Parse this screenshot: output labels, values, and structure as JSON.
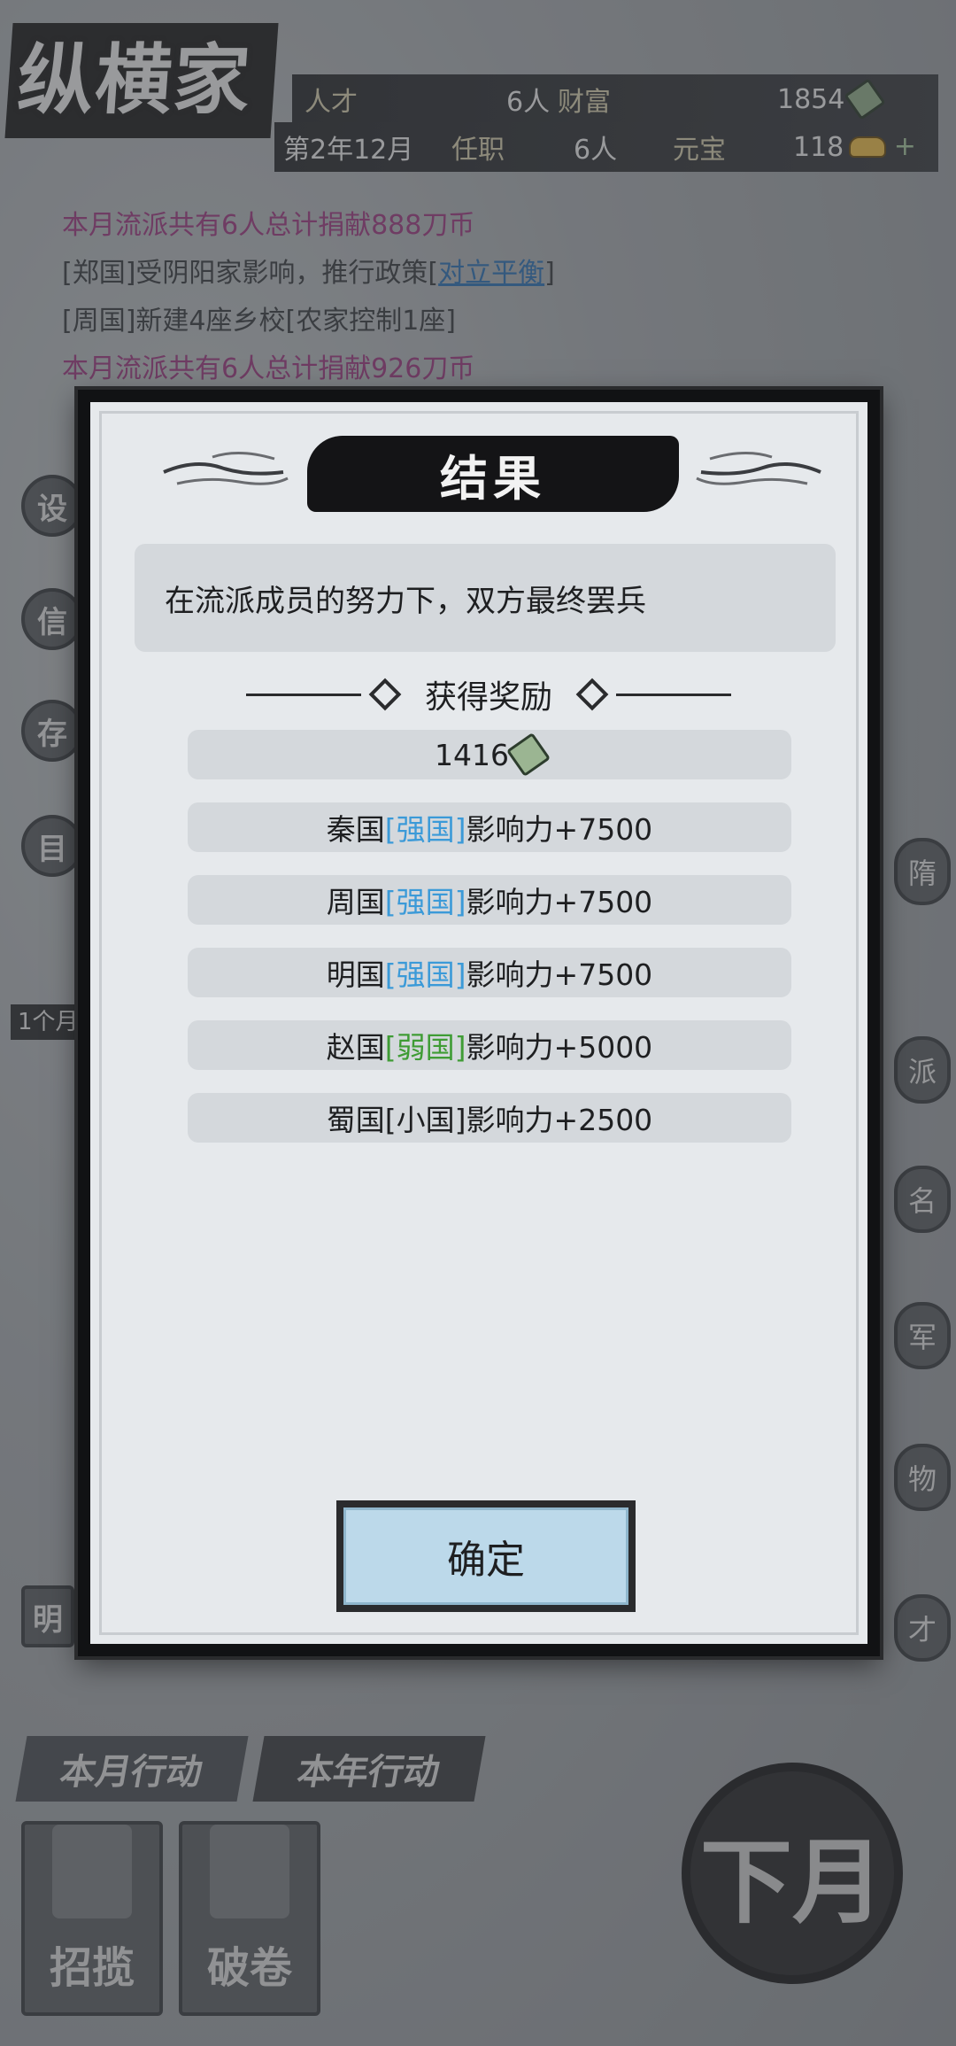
{
  "header": {
    "app_title": "纵横家",
    "row1": [
      {
        "label": "人才",
        "value": "6人"
      },
      {
        "label": "财富",
        "value": "1854"
      }
    ],
    "row2": [
      {
        "label": "",
        "value": "第2年12月"
      },
      {
        "label": "任职",
        "value": "6人"
      },
      {
        "label": "元宝",
        "value": "118"
      }
    ]
  },
  "log": [
    {
      "text": "本月流派共有6人总计捐献888刀币",
      "style": "purple"
    },
    {
      "text_before": "[郑国]受阴阳家影响，推行政策[",
      "link": "对立平衡",
      "text_after": "]",
      "style": "normal"
    },
    {
      "text": "[周国]新建4座乡校[农家控制1座]",
      "style": "normal"
    },
    {
      "text": "本月流派共有6人总计捐献926刀币",
      "style": "purple"
    }
  ],
  "side_left": [
    "设",
    "信",
    "存",
    "目"
  ],
  "side_right": [
    "隋",
    "派",
    "名",
    "军",
    "物",
    "才"
  ],
  "tag_1month": "1个月",
  "left_badge": "明",
  "modal": {
    "title": "结果",
    "message": "在流派成员的努力下，双方最终罢兵",
    "reward_header": "获得奖励",
    "coin_reward": "1416",
    "rewards": [
      {
        "country": "秦国",
        "tier": "[强国]",
        "tier_color": "blue",
        "text": "影响力+7500"
      },
      {
        "country": "周国",
        "tier": "[强国]",
        "tier_color": "blue",
        "text": "影响力+7500"
      },
      {
        "country": "明国",
        "tier": "[强国]",
        "tier_color": "blue",
        "text": "影响力+7500"
      },
      {
        "country": "赵国",
        "tier": "[弱国]",
        "tier_color": "green",
        "text": "影响力+5000"
      },
      {
        "country": "蜀国",
        "tier": "[小国]",
        "tier_color": "plain",
        "text": "影响力+2500"
      }
    ],
    "confirm_label": "确定"
  },
  "bottom": {
    "tabs": [
      "本月行动",
      "本年行动"
    ],
    "actions": [
      {
        "label": "招揽",
        "icon": "recruit-icon"
      },
      {
        "label": "破卷",
        "icon": "scroll-icon"
      }
    ],
    "next_month": "下月"
  },
  "colors": {
    "tier_blue": "#3b9ad8",
    "tier_green": "#3f9c35",
    "log_purple": "#9a3b7e",
    "confirm_bg": "#bcd9ea"
  }
}
